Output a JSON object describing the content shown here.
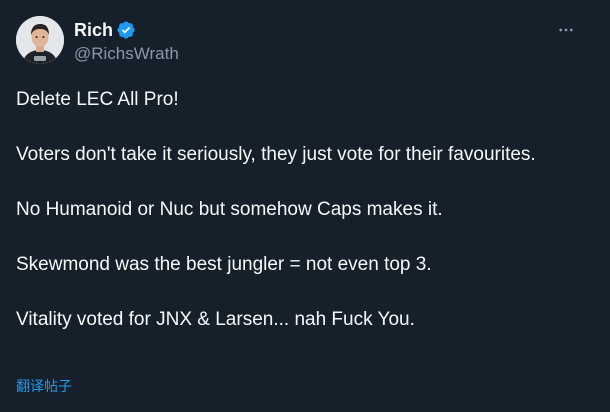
{
  "author": {
    "display_name": "Rich",
    "handle": "@RichsWrath",
    "avatar_icon": "profile-photo",
    "verified_icon": "verified-badge-icon"
  },
  "tweet": {
    "paragraphs": [
      "Delete LEC All Pro!",
      "Voters don't take it seriously, they just vote for their favourites.",
      "No Humanoid or Nuc but somehow Caps makes it.",
      "Skewmond was the best jungler = not even top 3.",
      "Vitality voted for JNX & Larsen... nah Fuck You."
    ]
  },
  "actions": {
    "translate_label": "翻译帖子",
    "more_icon": "more-horizontal-icon"
  },
  "colors": {
    "background": "#15202b",
    "text": "#f7f9f9",
    "secondary_text": "#8b98a5",
    "accent": "#1d9bf0"
  }
}
